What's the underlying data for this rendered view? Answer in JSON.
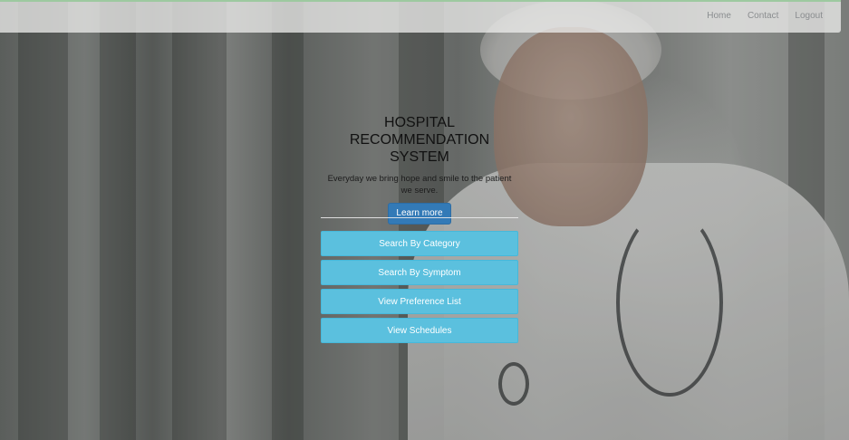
{
  "navbar": {
    "links": [
      "Home",
      "Contact",
      "Logout"
    ]
  },
  "hero": {
    "title_line1": "HOSPITAL",
    "title_line2": "RECOMMENDATION SYSTEM",
    "subtitle": "Everyday we bring hope and smile to the patient we serve.",
    "learn_more_label": "Learn more"
  },
  "menu": {
    "buttons": [
      "Search By Category",
      "Search By Symptom",
      "View Preference List",
      "View Schedules"
    ]
  },
  "colors": {
    "primary_button": "#337ab7",
    "info_button": "#5bc0de",
    "navbar_border": "#9dc9a0"
  }
}
